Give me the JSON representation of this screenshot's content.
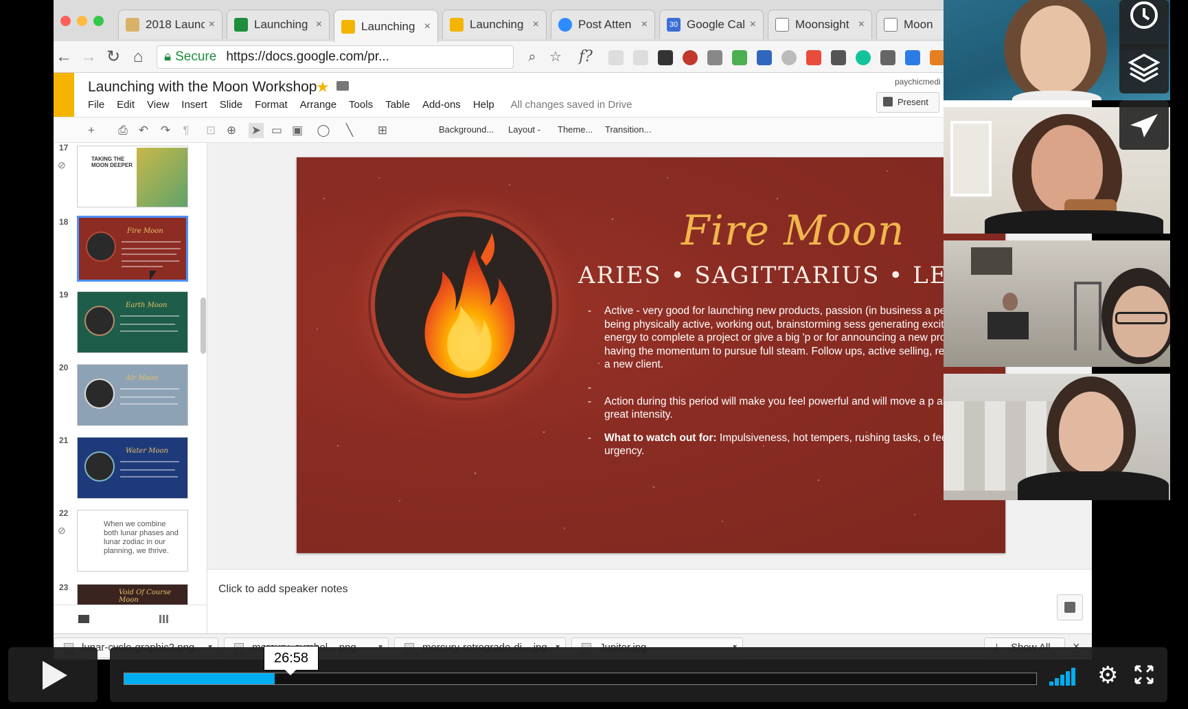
{
  "browser": {
    "tabs": [
      {
        "label": "2018 Launc",
        "fav_color": "#d9b26a"
      },
      {
        "label": "Launching",
        "fav_color": "#1e8e3e"
      },
      {
        "label": "Launching",
        "fav_color": "#f4b400",
        "active": true
      },
      {
        "label": "Launching",
        "fav_color": "#f4b400"
      },
      {
        "label": "Post Atten",
        "fav_color": "#2d8cff"
      },
      {
        "label": "Google Cal",
        "fav_color": "#3b6fd6",
        "fav_text": "30"
      },
      {
        "label": "Moonsight",
        "fav_color": "#ffffff"
      },
      {
        "label": "Moon",
        "fav_color": "#ffffff"
      }
    ],
    "secure_label": "Secure",
    "url": "https://docs.google.com/pr...",
    "formula_ext": "f?"
  },
  "docs": {
    "title": "Launching with the Moon Workshop",
    "menu": [
      "File",
      "Edit",
      "View",
      "Insert",
      "Slide",
      "Format",
      "Arrange",
      "Tools",
      "Table",
      "Add-ons",
      "Help"
    ],
    "saved_status": "All changes saved in Drive",
    "account": "paychicmedi",
    "present_label": "Present"
  },
  "toolbar": {
    "background": "Background...",
    "layout": "Layout -",
    "theme": "Theme...",
    "transition": "Transition..."
  },
  "filmstrip": {
    "numbers": [
      "17",
      "18",
      "19",
      "20",
      "21",
      "22",
      "23"
    ],
    "slide17_title": "TAKING THE MOON DEEPER",
    "slide19_title": "Earth Moon",
    "slide20_title": "Air Moon",
    "slide21_title": "Water Moon",
    "slide22_text": "When we combine both lunar phases and lunar zodiac in our planning, we thrive.",
    "slide23_title": "Void Of Course Moon"
  },
  "slide": {
    "title": "Fire Moon",
    "subtitle": "ARIES • SAGITTARIUS • LEO",
    "bullet1": "Active - very good for launching new products, passion (in business a personal life), being physically active, working out, brainstorming sess generating excitement or energy to complete a project or give a big 'p or for announcing a new project and having the momentum to pursue full steam. Follow ups, active selling, reaching out to a new client.",
    "bullet3": "Action during this period will make you feel powerful and will move a p ahead with great intensity.",
    "bullet4_bold": "What to watch out for:",
    "bullet4_rest": " Impulsiveness, hot tempers, rushing tasks, o feelings of urgency.",
    "dash": "-"
  },
  "notes": {
    "placeholder": "Click to add speaker notes"
  },
  "downloads": {
    "items": [
      "lunar-cycle-graphic2.png",
      "mercury_symbol....png",
      "mercury-retrograde-di....jpg",
      "Jupiter.jpg"
    ],
    "show_all": "Show All",
    "close": "×"
  },
  "player": {
    "current_time": "26:58",
    "progress": 0.165,
    "accent": "#00adef"
  }
}
